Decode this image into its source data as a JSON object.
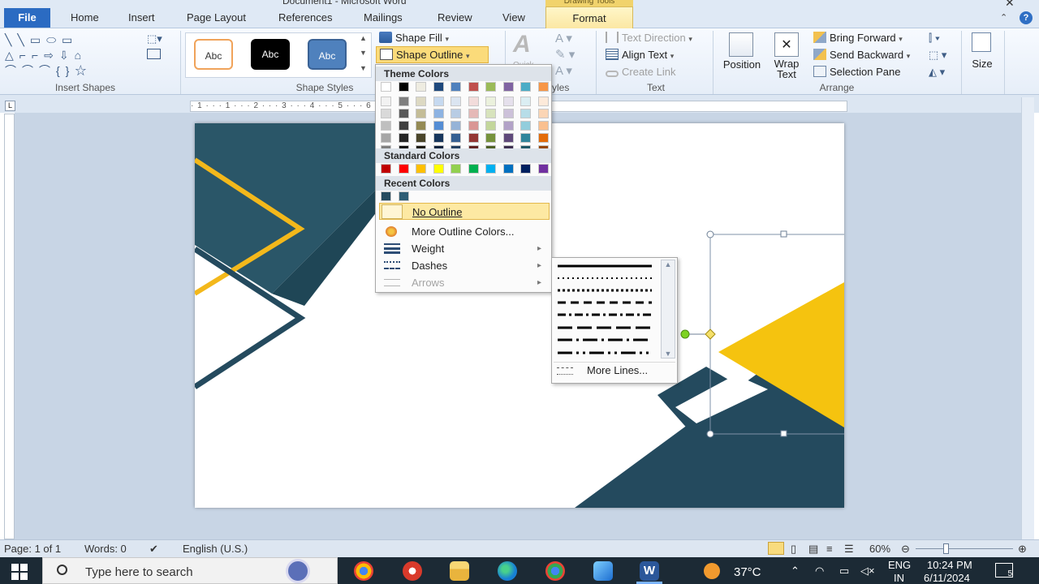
{
  "window": {
    "title": "Document1 - Microsoft Word",
    "context_tab": "Drawing Tools"
  },
  "tabs": {
    "file": "File",
    "home": "Home",
    "insert": "Insert",
    "page_layout": "Page Layout",
    "references": "References",
    "mailings": "Mailings",
    "review": "Review",
    "view": "View",
    "format": "Format"
  },
  "ribbon": {
    "groups": {
      "insert_shapes": "Insert Shapes",
      "shape_styles": "Shape Styles",
      "wordart_styles": "yles",
      "text": "Text",
      "arrange": "Arrange"
    },
    "shape_style_samples": [
      "Abc",
      "Abc",
      "Abc"
    ],
    "shape_fill": "Shape Fill",
    "shape_outline": "Shape Outline",
    "quick_styles": "Quick",
    "text_direction": "Text Direction",
    "align_text": "Align Text",
    "create_link": "Create Link",
    "position": "Position",
    "wrap_text_line1": "Wrap",
    "wrap_text_line2": "Text",
    "bring_forward": "Bring Forward",
    "send_backward": "Send Backward",
    "selection_pane": "Selection Pane",
    "size": "Size"
  },
  "ruler": {
    "marks": "· 1 · · · 1 · · · 2 · · · 3 · · · 4 · · · 5 · · · 6 · · · 7 · · · 8 · · · 9 · · ·"
  },
  "outline_menu": {
    "theme_colors_label": "Theme Colors",
    "standard_colors_label": "Standard Colors",
    "recent_colors_label": "Recent Colors",
    "no_outline": "No Outline",
    "more_outline_colors": "More Outline Colors...",
    "weight": "Weight",
    "dashes": "Dashes",
    "arrows": "Arrows",
    "theme_top_row": [
      "#ffffff",
      "#000000",
      "#eeece1",
      "#1f497d",
      "#4f81bd",
      "#c0504d",
      "#9bbb59",
      "#8064a2",
      "#4bacc6",
      "#f79646"
    ],
    "theme_shades": [
      [
        "#f2f2f2",
        "#d9d9d9",
        "#bfbfbf",
        "#a6a6a6",
        "#808080"
      ],
      [
        "#7f7f7f",
        "#595959",
        "#404040",
        "#262626",
        "#0d0d0d"
      ],
      [
        "#ddd9c3",
        "#c4bd97",
        "#948a54",
        "#4a452a",
        "#1d1b10"
      ],
      [
        "#c6d9f0",
        "#8db3e2",
        "#548dd4",
        "#17365d",
        "#0f243e"
      ],
      [
        "#dbe5f1",
        "#b8cce4",
        "#95b3d7",
        "#366092",
        "#244061"
      ],
      [
        "#f2dcdb",
        "#e5b9b7",
        "#d99694",
        "#953734",
        "#632423"
      ],
      [
        "#ebf1dd",
        "#d7e3bc",
        "#c3d69b",
        "#76923c",
        "#4f6128"
      ],
      [
        "#e5e0ec",
        "#ccc1d9",
        "#b2a2c7",
        "#5f497a",
        "#3f3151"
      ],
      [
        "#dbeef3",
        "#b7dde8",
        "#92cddc",
        "#31859b",
        "#205867"
      ],
      [
        "#fdeada",
        "#fbd5b5",
        "#fac08f",
        "#e36c09",
        "#974806"
      ]
    ],
    "standard_colors": [
      "#c00000",
      "#ff0000",
      "#ffc000",
      "#ffff00",
      "#92d050",
      "#00b050",
      "#00b0f0",
      "#0070c0",
      "#002060",
      "#7030a0"
    ],
    "recent_colors": [
      "#244a5e",
      "#2e5d74"
    ]
  },
  "dash_menu": {
    "more_lines": "More Lines..."
  },
  "status": {
    "page": "Page: 1 of 1",
    "words": "Words: 0",
    "language": "English (U.S.)",
    "zoom": "60%"
  },
  "taskbar": {
    "search_placeholder": "Type here to search",
    "temperature": "37°C",
    "lang_line1": "ENG",
    "lang_line2": "IN",
    "time": "10:24 PM",
    "date": "6/11/2024",
    "notification_count": "5"
  }
}
